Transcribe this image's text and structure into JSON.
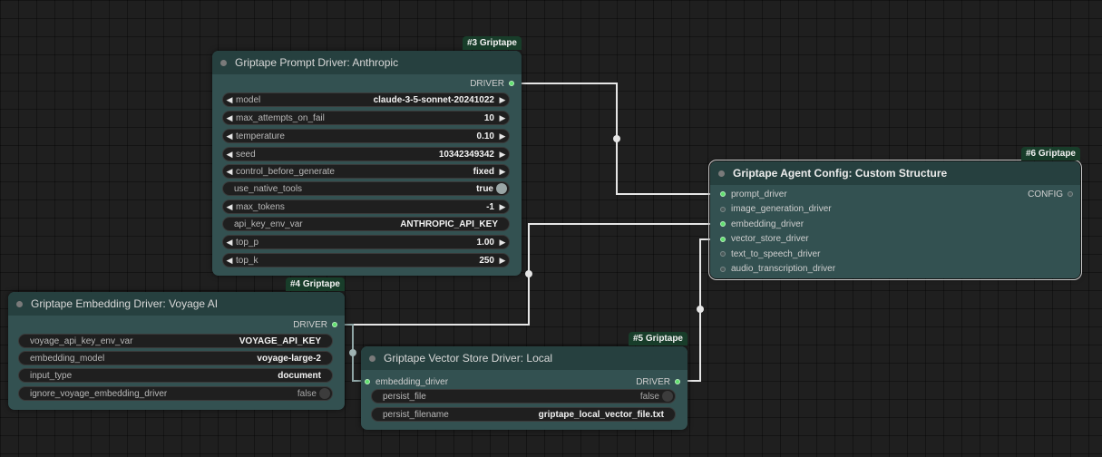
{
  "canvas": {
    "background": "#1f1f1f"
  },
  "colors": {
    "node_body": "#335151",
    "node_header": "#26403f",
    "link": "#e6e6e6",
    "slot_active": "#5fe06e",
    "badge": "#183d2a"
  },
  "nodes": {
    "prompt": {
      "badge": "#3 Griptape",
      "title": "Griptape Prompt Driver: Anthropic",
      "output": "DRIVER",
      "widgets": {
        "model": {
          "label": "model",
          "value": "claude-3-5-sonnet-20241022"
        },
        "max_attempts": {
          "label": "max_attempts_on_fail",
          "value": "10"
        },
        "temperature": {
          "label": "temperature",
          "value": "0.10"
        },
        "seed": {
          "label": "seed",
          "value": "10342349342"
        },
        "control": {
          "label": "control_before_generate",
          "value": "fixed"
        },
        "native_tools": {
          "label": "use_native_tools",
          "value": "true"
        },
        "max_tokens": {
          "label": "max_tokens",
          "value": "-1"
        },
        "api_key": {
          "label": "api_key_env_var",
          "value": "ANTHROPIC_API_KEY"
        },
        "top_p": {
          "label": "top_p",
          "value": "1.00"
        },
        "top_k": {
          "label": "top_k",
          "value": "250"
        }
      }
    },
    "embedding": {
      "badge": "#4 Griptape",
      "title": "Griptape Embedding Driver: Voyage AI",
      "output": "DRIVER",
      "widgets": {
        "api_key": {
          "label": "voyage_api_key_env_var",
          "value": "VOYAGE_API_KEY"
        },
        "model": {
          "label": "embedding_model",
          "value": "voyage-large-2"
        },
        "input_type": {
          "label": "input_type",
          "value": "document"
        },
        "ignore": {
          "label": "ignore_voyage_embedding_driver",
          "value": "false"
        }
      }
    },
    "vector": {
      "badge": "#5 Griptape",
      "title": "Griptape Vector Store Driver: Local",
      "input": "embedding_driver",
      "output": "DRIVER",
      "widgets": {
        "persist_file": {
          "label": "persist_file",
          "value": "false"
        },
        "persist_filename": {
          "label": "persist_filename",
          "value": "griptape_local_vector_file.txt"
        }
      }
    },
    "agent": {
      "badge": "#6 Griptape",
      "title": "Griptape Agent Config: Custom Structure",
      "output": "CONFIG",
      "inputs": [
        "prompt_driver",
        "image_generation_driver",
        "embedding_driver",
        "vector_store_driver",
        "text_to_speech_driver",
        "audio_transcription_driver"
      ]
    }
  }
}
